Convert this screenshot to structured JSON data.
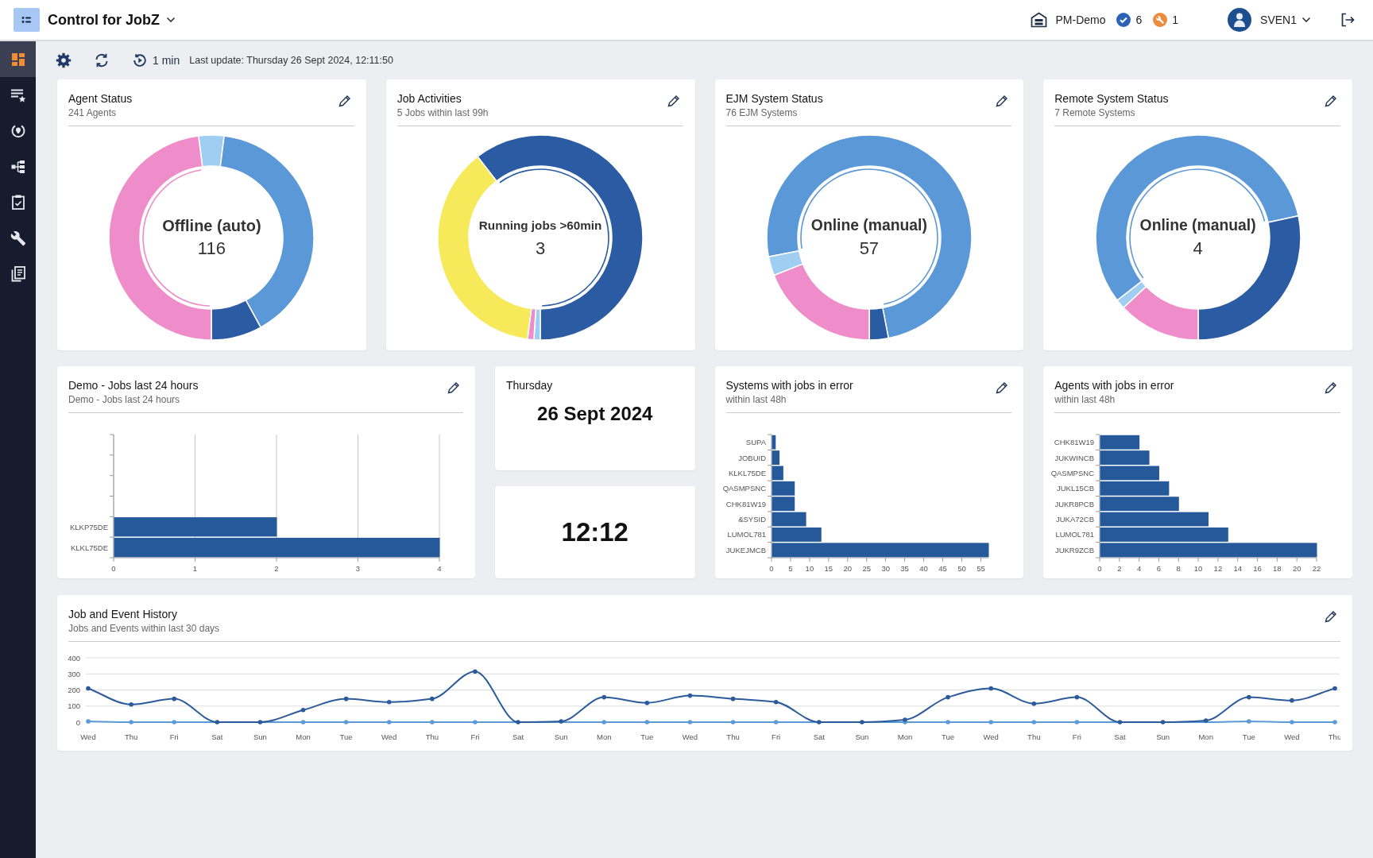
{
  "app_bar": {
    "title": "Control for JobZ",
    "environment": "PM-Demo",
    "ok_count": "6",
    "warning_count": "1",
    "user": "SVEN1"
  },
  "sidebar": {
    "items": [
      {
        "selected": true
      },
      {
        "selected": false
      },
      {
        "selected": false
      },
      {
        "selected": false
      },
      {
        "selected": false
      },
      {
        "selected": false
      },
      {
        "selected": false
      }
    ]
  },
  "toolbar": {
    "refresh_interval": "1 min",
    "last_update": "Last update: Thursday 26 Sept 2024, 12:11:50"
  },
  "status_cards": [
    {
      "title": "Agent Status",
      "subtitle": "241 Agents",
      "center_label": "Offline (auto)",
      "center_value": "116"
    },
    {
      "title": "Job Activities",
      "subtitle": "5 Jobs within last 99h",
      "center_label": "Running jobs >60min",
      "center_value": "3"
    },
    {
      "title": "EJM System Status",
      "subtitle": "76 EJM Systems",
      "center_label": "Online (manual)",
      "center_value": "57"
    },
    {
      "title": "Remote System Status",
      "subtitle": "7 Remote Systems",
      "center_label": "Online (manual)",
      "center_value": "4"
    }
  ],
  "demo_jobs": {
    "title": "Demo - Jobs last 24 hours",
    "subtitle": "Demo - Jobs last 24 hours",
    "chart_data": {
      "type": "bar",
      "orientation": "horizontal",
      "categories": [
        "KLKP75DE",
        "KLKL75DE"
      ],
      "values": [
        2,
        4
      ],
      "xlim": [
        0,
        4
      ],
      "xticks": [
        0,
        1,
        2,
        3,
        4
      ],
      "grid": true
    }
  },
  "date_card": {
    "weekday": "Thursday",
    "date": "26 Sept 2024"
  },
  "time_card": {
    "time": "12:12"
  },
  "error_cards": [
    {
      "title": "Systems with jobs in error",
      "subtitle": "within last 48h",
      "chart_data": {
        "type": "bar",
        "orientation": "horizontal",
        "categories": [
          "SUPA",
          "JOBUID",
          "KLKL75DE",
          "QASMPSNC",
          "CHK81W19",
          "&SYSID",
          "LUMOL781",
          "JUKEJMCB"
        ],
        "values": [
          1,
          2,
          3,
          6,
          6,
          9,
          13,
          57
        ],
        "xlim": [
          0,
          57
        ],
        "xticks": [
          0,
          5,
          10,
          15,
          20,
          25,
          30,
          35,
          40,
          45,
          50,
          55
        ]
      }
    },
    {
      "title": "Agents with jobs in error",
      "subtitle": "within last 48h",
      "chart_data": {
        "type": "bar",
        "orientation": "horizontal",
        "categories": [
          "CHK81W19",
          "JUKWINCB",
          "QASMPSNC",
          "JUKL15CB",
          "JUKR8PCB",
          "JUKA72CB",
          "LUMOL781",
          "JUKR9ZCB"
        ],
        "values": [
          4,
          5,
          6,
          7,
          8,
          11,
          13,
          22
        ],
        "xlim": [
          0,
          22
        ],
        "xticks": [
          0,
          2,
          4,
          6,
          8,
          10,
          12,
          14,
          16,
          18,
          20,
          22
        ]
      }
    }
  ],
  "history": {
    "title": "Job and Event History",
    "subtitle": "Jobs and Events within last 30 days",
    "chart_data": {
      "type": "line",
      "categories": [
        "Wed",
        "Thu",
        "Fri",
        "Sat",
        "Sun",
        "Mon",
        "Tue",
        "Wed",
        "Thu",
        "Fri",
        "Sat",
        "Sun",
        "Mon",
        "Tue",
        "Wed",
        "Thu",
        "Fri",
        "Sat",
        "Sun",
        "Mon",
        "Tue",
        "Wed",
        "Thu",
        "Fri",
        "Sat",
        "Sun",
        "Mon",
        "Tue",
        "Wed",
        "Thu"
      ],
      "series": [
        {
          "color": "#2b5b9b",
          "values": [
            210,
            110,
            145,
            0,
            0,
            75,
            145,
            125,
            145,
            315,
            0,
            5,
            155,
            120,
            165,
            145,
            125,
            0,
            0,
            15,
            155,
            210,
            115,
            155,
            0,
            0,
            10,
            155,
            135,
            210
          ]
        },
        {
          "color": "#5d9ad8",
          "values": [
            5,
            0,
            0,
            0,
            0,
            0,
            0,
            0,
            0,
            0,
            0,
            0,
            0,
            0,
            0,
            0,
            0,
            0,
            0,
            0,
            0,
            0,
            0,
            0,
            0,
            0,
            0,
            5,
            0,
            0
          ]
        }
      ],
      "ylim": [
        0,
        400
      ],
      "yticks": [
        0,
        100,
        200,
        300,
        400
      ],
      "grid": true
    }
  }
}
